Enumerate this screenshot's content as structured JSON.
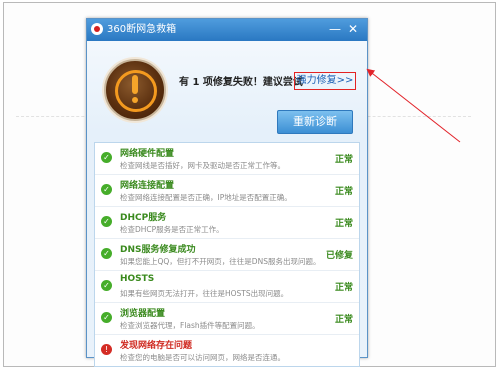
{
  "window": {
    "title": "360断网急救箱",
    "min_glyph": "—",
    "close_glyph": "✕"
  },
  "summary": {
    "message": "有 1 项修复失败！建议尝试",
    "repair_link": "强力修复>>",
    "rediagnose_button": "重新诊断"
  },
  "items": [
    {
      "title": "网络硬件配置",
      "desc": "检查网线是否插好，网卡及驱动是否正常工作等。",
      "status": "正常",
      "state": "ok"
    },
    {
      "title": "网络连接配置",
      "desc": "检查网络连接配置是否正确，IP地址是否配置正确。",
      "status": "正常",
      "state": "ok"
    },
    {
      "title": "DHCP服务",
      "desc": "检查DHCP服务是否正常工作。",
      "status": "正常",
      "state": "ok"
    },
    {
      "title": "DNS服务修复成功",
      "desc": "如果您能上QQ，但打不开网页，往往是DNS服务出现问题。",
      "status": "已修复",
      "state": "ok"
    },
    {
      "title": "HOSTS",
      "desc": "如果有些网页无法打开，往往是HOSTS出现问题。",
      "status": "正常",
      "state": "ok"
    },
    {
      "title": "浏览器配置",
      "desc": "检查浏览器代理，Flash插件等配置问题。",
      "status": "正常",
      "state": "ok"
    },
    {
      "title": "发现网络存在问题",
      "desc": "检查您的电脑是否可以访问网页，网络是否连通。",
      "status": "",
      "state": "error"
    }
  ],
  "icons": {
    "ok": "check-icon",
    "error": "error-icon"
  },
  "colors": {
    "accent": "#2a78c2",
    "ok": "#3a8a1e",
    "error": "#cf2920",
    "annotation": "#e2232a"
  }
}
